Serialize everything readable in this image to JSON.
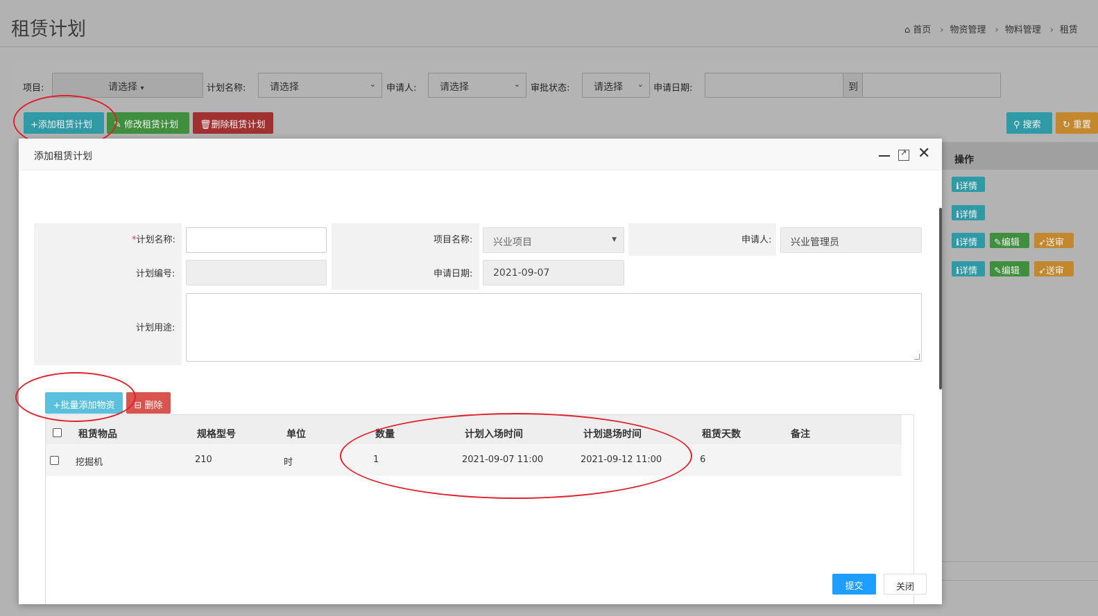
{
  "page": {
    "title": "租赁计划",
    "breadcrumb": [
      "首页",
      "物资管理",
      "物料管理",
      "租赁"
    ]
  },
  "filters": {
    "project_label": "项目:",
    "project_value": "请选择",
    "plan_name_label": "计划名称:",
    "plan_name_value": "请选择",
    "applicant_label": "申请人:",
    "applicant_value": "请选择",
    "approval_label": "审批状态:",
    "approval_value": "请选择",
    "date_label": "申请日期:",
    "date_to": "到"
  },
  "toolbar": {
    "add": "添加租赁计划",
    "edit": "修改租赁计划",
    "delete": "删除租赁计划",
    "search": "搜索",
    "reset": "重置"
  },
  "bg_table": {
    "ops_header": "操作",
    "detail": "详情",
    "edit": "编辑",
    "send": "送审"
  },
  "modal": {
    "title": "添加租赁计划",
    "form": {
      "plan_name_label": "计划名称:",
      "project_name_label": "项目名称:",
      "project_name_value": "兴业项目",
      "applicant_label": "申请人:",
      "applicant_value": "兴业管理员",
      "plan_no_label": "计划编号:",
      "apply_date_label": "申请日期:",
      "apply_date_value": "2021-09-07",
      "purpose_label": "计划用途:"
    },
    "batch_add": "批量添加物资",
    "remove": "删除",
    "columns": [
      "租赁物品",
      "规格型号",
      "单位",
      "数量",
      "计划入场时间",
      "计划退场时间",
      "租赁天数",
      "备注"
    ],
    "rows": [
      [
        "挖掘机",
        "210",
        "时",
        "1",
        "2021-09-07 11:00",
        "2021-09-12 11:00",
        "6",
        ""
      ]
    ],
    "submit": "提交",
    "close": "关闭"
  },
  "colors": {
    "primary": "#1e9fff",
    "info": "#5bc0de",
    "danger": "#d9534f",
    "annotation": "#e0202a"
  }
}
